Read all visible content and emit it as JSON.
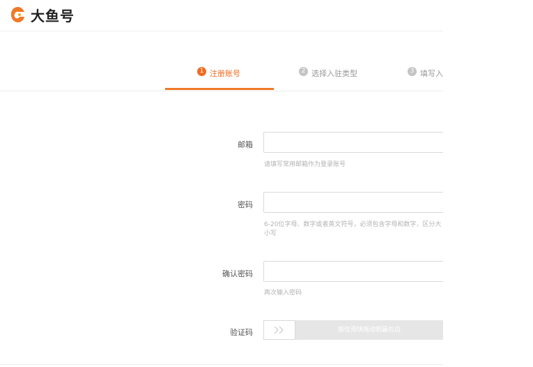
{
  "brand": {
    "name": "大鱼号",
    "accent": "#f07826"
  },
  "steps": [
    {
      "num": "1",
      "label": "注册账号",
      "active": true
    },
    {
      "num": "2",
      "label": "选择入驻类型",
      "active": false
    },
    {
      "num": "3",
      "label": "填写入",
      "active": false
    }
  ],
  "form": {
    "email": {
      "label": "邮箱",
      "value": "",
      "hint": "请填写常用邮箱作为登录账号"
    },
    "password": {
      "label": "密码",
      "value": "",
      "hint": "6-20位字母、数字或者英文符号，必须包含字母和数字，区分大小写"
    },
    "confirm": {
      "label": "确认密码",
      "value": "",
      "hint": "再次输入密码"
    },
    "captcha": {
      "label": "验证码",
      "slider_text": "按住滑块拖动到最右边",
      "handle_icon": "double-chevron-right-icon"
    }
  }
}
